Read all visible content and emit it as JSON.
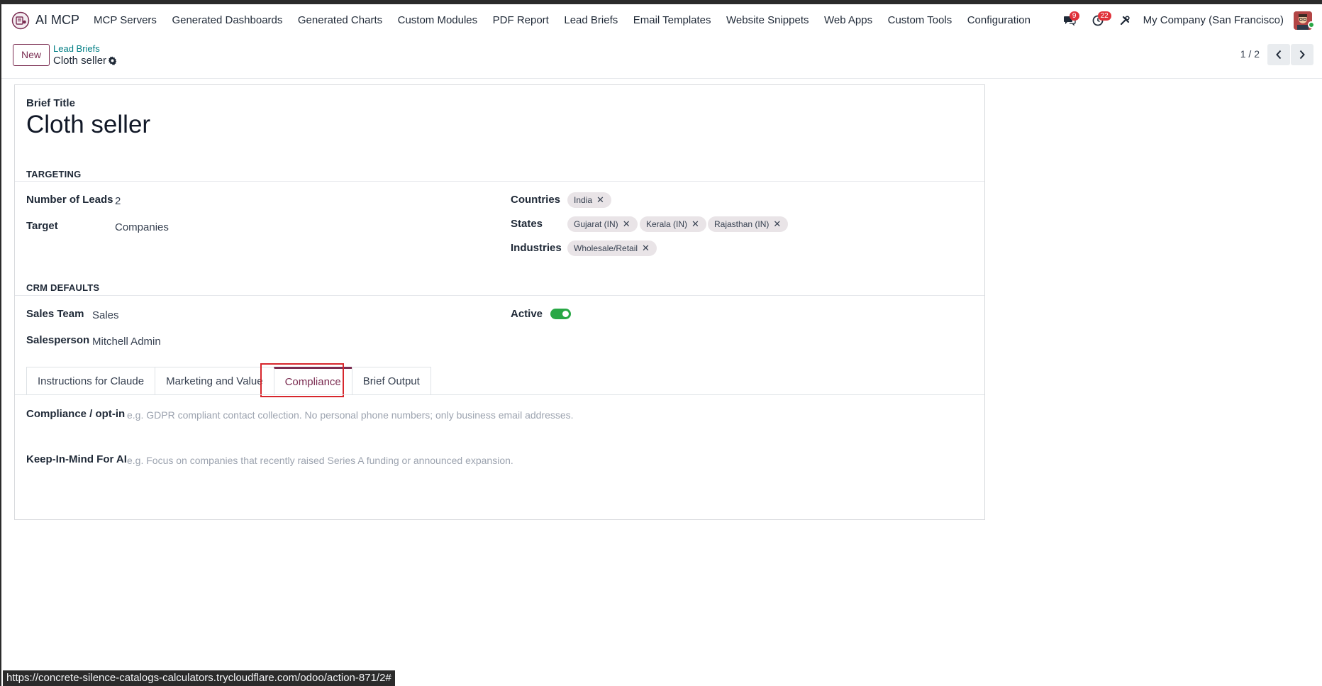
{
  "app": {
    "name": "AI MCP",
    "logo_icon": "ai-mcp-app-icon"
  },
  "menu": {
    "items": [
      "MCP Servers",
      "Generated Dashboards",
      "Generated Charts",
      "Custom Modules",
      "PDF Report",
      "Lead Briefs",
      "Email Templates",
      "Website Snippets",
      "Web Apps",
      "Custom Tools",
      "Configuration"
    ]
  },
  "systray": {
    "messages_count": "9",
    "activities_count": "22",
    "company": "My Company (San Francisco)"
  },
  "control_panel": {
    "new_label": "New",
    "breadcrumb_parent": "Lead Briefs",
    "breadcrumb_current": "Cloth seller",
    "pager_value": "1 / 2"
  },
  "form": {
    "title_label": "Brief Title",
    "title_value": "Cloth seller",
    "targeting": {
      "section_title": "TARGETING",
      "leads_label": "Number of Leads",
      "leads_value": "2",
      "target_label": "Target",
      "target_value": "Companies",
      "countries_label": "Countries",
      "countries": [
        "India"
      ],
      "states_label": "States",
      "states": [
        "Gujarat (IN)",
        "Kerala (IN)",
        "Rajasthan (IN)"
      ],
      "industries_label": "Industries",
      "industries": [
        "Wholesale/Retail"
      ]
    },
    "crm": {
      "section_title": "CRM DEFAULTS",
      "team_label": "Sales Team",
      "team_value": "Sales",
      "salesperson_label": "Salesperson",
      "salesperson_value": "Mitchell Admin",
      "active_label": "Active",
      "active": true
    },
    "tabs": [
      "Instructions for Claude",
      "Marketing and Value",
      "Compliance",
      "Brief Output"
    ],
    "active_tab": "Compliance",
    "compliance": {
      "optin_label": "Compliance / opt-in",
      "optin_placeholder": "e.g. GDPR compliant contact collection. No personal phone numbers; only business email addresses.",
      "keep_label": "Keep-In-Mind For AI",
      "keep_placeholder": "e.g. Focus on companies that recently raised Series A funding or announced expansion."
    }
  },
  "status_url": "https://concrete-silence-catalogs-calculators.trycloudflare.com/odoo/action-871/2#",
  "colors": {
    "brand": "#7b2d52",
    "link": "#017e84",
    "toggle_on": "#28a745",
    "badge": "#e0323a",
    "highlight": "#d7262c"
  }
}
